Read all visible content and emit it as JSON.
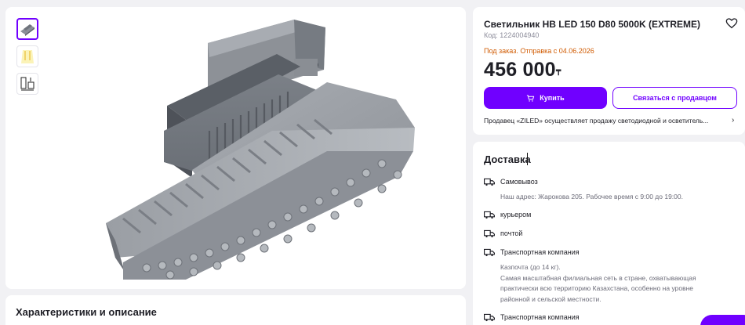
{
  "gallery": {
    "thumbnails": [
      {
        "name": "thumb-product-fixture",
        "active": true
      },
      {
        "name": "thumb-light-beam",
        "active": false
      },
      {
        "name": "thumb-dimension-drawing",
        "active": false
      }
    ]
  },
  "product": {
    "title": "Светильник HB LED 150 D80 5000K (EXTREME)",
    "code": "Код: 1224004940",
    "order_status": "Под заказ. Отправка с 04.06.2026",
    "price": "456 000",
    "currency": "₸",
    "buy_label": "Купить",
    "contact_label": "Связаться с продавцом",
    "seller_text": "Продавец «ZILED» осуществляет продажу светодиодной и осветитель..."
  },
  "delivery": {
    "title": "Доставка",
    "options": [
      {
        "label": "Самовывоз",
        "note": "Наш адрес: Жарокова 205. Рабочее время с 9:00 до 19:00."
      },
      {
        "label": "курьером",
        "note": ""
      },
      {
        "label": "почтой",
        "note": ""
      },
      {
        "label": "Транспортная компания",
        "note": "Казпочта (до 14 кг).\nСамая масштабная филиальная сеть в стране, охватывающая практически всю территорию Казахстана, особенно на уровне районной и сельской местности."
      },
      {
        "label": "Транспортная компания",
        "note": ""
      }
    ]
  },
  "description": {
    "title": "Характеристики и описание"
  },
  "colors": {
    "accent": "#7000ff",
    "order_status": "#d05a00",
    "background": "#f1f1f4"
  },
  "icons": [
    "heart-icon",
    "cart-icon",
    "chevron-right-icon",
    "truck-icon"
  ]
}
